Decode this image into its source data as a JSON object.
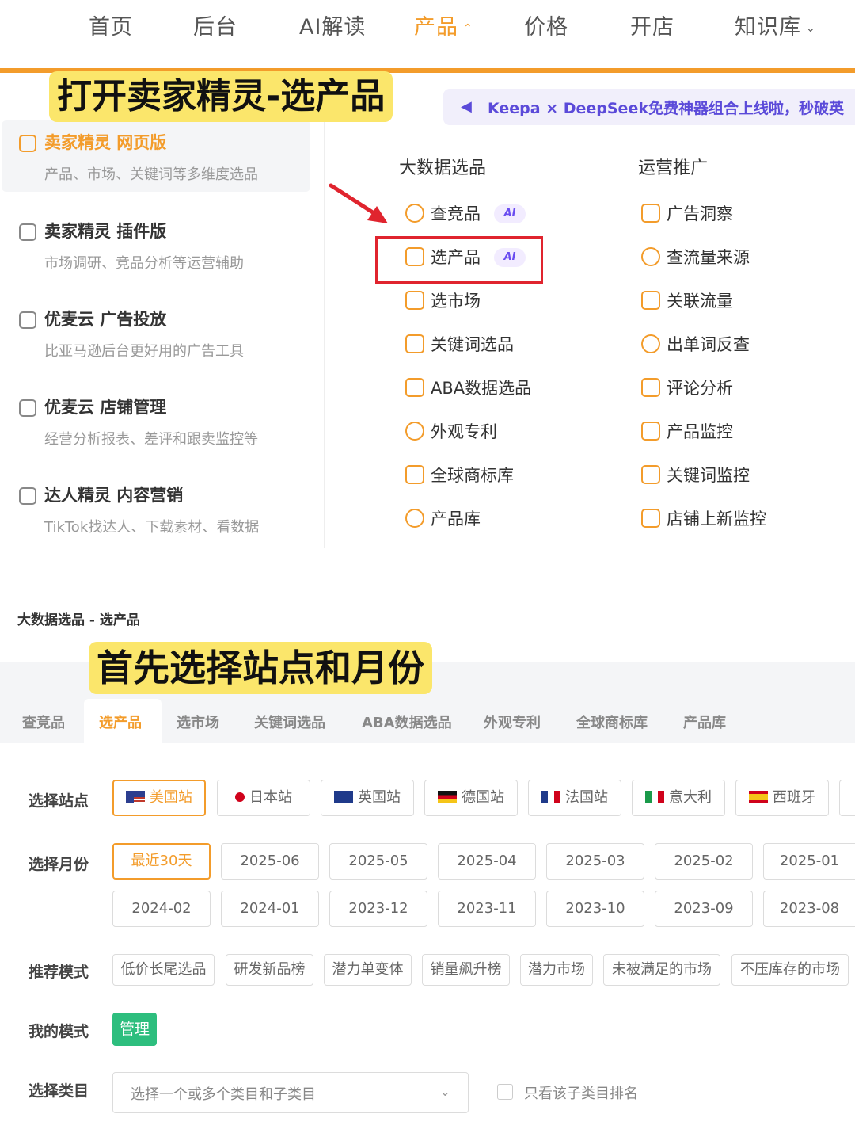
{
  "nav": {
    "items": [
      {
        "label": "首页"
      },
      {
        "label": "后台"
      },
      {
        "label": "AI解读"
      },
      {
        "label": "产品",
        "chevron": "⌃"
      },
      {
        "label": "价格"
      },
      {
        "label": "开店"
      },
      {
        "label": "知识库",
        "chevron": "⌄"
      }
    ],
    "active_index": 3
  },
  "annotations": {
    "title1": "打开卖家精灵-选产品",
    "title2": "首先选择站点和月份"
  },
  "products": [
    {
      "title": "卖家精灵 网页版",
      "desc": "产品、市场、关键词等多维度选品"
    },
    {
      "title": "卖家精灵 插件版",
      "desc": "市场调研、竞品分析等运营辅助"
    },
    {
      "title": "优麦云 广告投放",
      "desc": "比亚马逊后台更好用的广告工具"
    },
    {
      "title": "优麦云 店铺管理",
      "desc": "经营分析报表、差评和跟卖监控等"
    },
    {
      "title": "达人精灵 内容营销",
      "desc": "TikTok找达人、下载素材、看数据"
    }
  ],
  "banner": {
    "text": "Keepa × DeepSeek免费神器组合上线啦，秒破英"
  },
  "menu": {
    "col1_title": "大数据选品",
    "col2_title": "运营推广",
    "col1_items": [
      {
        "label": "查竞品",
        "ai": "AI"
      },
      {
        "label": "选产品",
        "ai": "AI"
      },
      {
        "label": "选市场"
      },
      {
        "label": "关键词选品"
      },
      {
        "label": "ABA数据选品"
      },
      {
        "label": "外观专利"
      },
      {
        "label": "全球商标库"
      },
      {
        "label": "产品库"
      }
    ],
    "col2_items": [
      {
        "label": "广告洞察"
      },
      {
        "label": "查流量来源"
      },
      {
        "label": "关联流量"
      },
      {
        "label": "出单词反查"
      },
      {
        "label": "评论分析"
      },
      {
        "label": "产品监控"
      },
      {
        "label": "关键词监控"
      },
      {
        "label": "店铺上新监控"
      }
    ]
  },
  "breadcrumb": "大数据选品 - 选产品",
  "tabs": [
    "查竞品",
    "选产品",
    "选市场",
    "关键词选品",
    "ABA数据选品",
    "外观专利",
    "全球商标库",
    "产品库"
  ],
  "filters": {
    "site_label": "选择站点",
    "sites": [
      "美国站",
      "日本站",
      "英国站",
      "德国站",
      "法国站",
      "意大利",
      "西班牙"
    ],
    "month_label": "选择月份",
    "months_row1": [
      "最近30天",
      "2025-06",
      "2025-05",
      "2025-04",
      "2025-03",
      "2025-02",
      "2025-01"
    ],
    "months_row2": [
      "2024-02",
      "2024-01",
      "2023-12",
      "2023-11",
      "2023-10",
      "2023-09",
      "2023-08"
    ],
    "mode_label": "推荐模式",
    "modes": [
      "低价长尾选品",
      "研发新品榜",
      "潜力单变体",
      "销量飙升榜",
      "潜力市场",
      "未被满足的市场",
      "不压库存的市场"
    ],
    "my_mode_label": "我的模式",
    "manage": "管理",
    "category_label": "选择类目",
    "category_placeholder": "选择一个或多个类目和子类目",
    "only_sub_label": "只看该子类目排名"
  },
  "colors": {
    "accent": "#f39c2b",
    "highlight": "#fbe66b",
    "red": "#e0242e",
    "green": "#2dbe7e",
    "ai": "#6a4df0"
  }
}
